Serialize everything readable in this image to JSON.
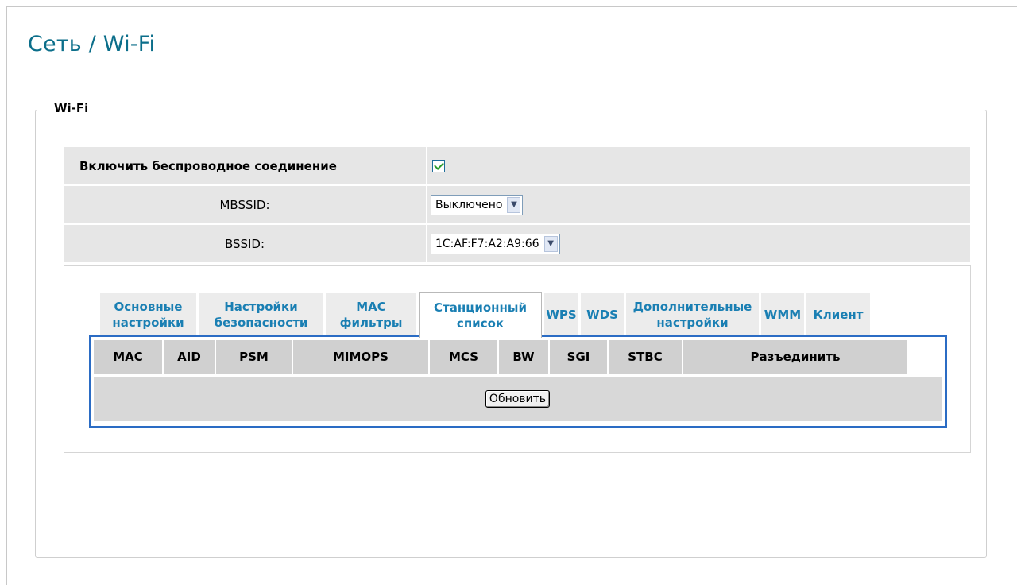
{
  "page": {
    "title": "Сеть / Wi-Fi"
  },
  "section": {
    "legend": "Wi-Fi"
  },
  "settings": {
    "enable_label": "Включить беспроводное соединение",
    "enable_checked": true,
    "mbssid_label": "MBSSID:",
    "mbssid_value": "Выключено",
    "bssid_label": "BSSID:",
    "bssid_value": "1C:AF:F7:A2:A9:66"
  },
  "tabs": [
    {
      "line1": "Основные",
      "line2": "настройки",
      "active": false
    },
    {
      "line1": "Настройки",
      "line2": "безопасности",
      "active": false
    },
    {
      "line1": "MAC",
      "line2": "фильтры",
      "active": false
    },
    {
      "line1": "Станционный",
      "line2": "список",
      "active": true
    },
    {
      "line1": "WPS",
      "line2": "",
      "active": false
    },
    {
      "line1": "WDS",
      "line2": "",
      "active": false
    },
    {
      "line1": "Дополнительные",
      "line2": "настройки",
      "active": false
    },
    {
      "line1": "WMM",
      "line2": "",
      "active": false
    },
    {
      "line1": "Клиент",
      "line2": "",
      "active": false
    }
  ],
  "station_table": {
    "columns": [
      "MAC",
      "AID",
      "PSM",
      "MIMOPS",
      "MCS",
      "BW",
      "SGI",
      "STBC",
      "Разъединить"
    ],
    "refresh_label": "Обновить"
  },
  "colors": {
    "title": "#0b6e8a",
    "tab_text": "#1a7fb3",
    "panel_border": "#2b6cc4"
  }
}
